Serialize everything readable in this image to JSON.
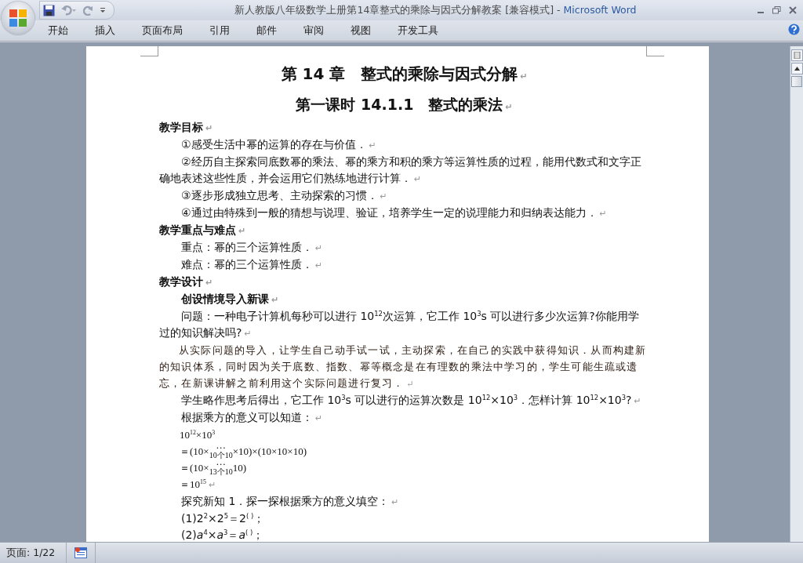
{
  "window": {
    "title": "新人教版八年级数学上册第14章整式的乘除与因式分解教案 [兼容模式]",
    "separator": " - ",
    "app": "Microsoft Word"
  },
  "tabs": [
    {
      "label": "开始",
      "selected": false
    },
    {
      "label": "插入",
      "selected": false
    },
    {
      "label": "页面布局",
      "selected": false
    },
    {
      "label": "引用",
      "selected": false
    },
    {
      "label": "邮件",
      "selected": false
    },
    {
      "label": "审阅",
      "selected": false
    },
    {
      "label": "视图",
      "selected": false
    },
    {
      "label": "开发工具",
      "selected": false
    }
  ],
  "document": {
    "paragraphs": [
      {
        "kind": "heading1",
        "text": "第 14 章　整式的乘除与因式分解",
        "mark": "↵"
      },
      {
        "kind": "heading2",
        "text": "第一课时 14.1.1　整式的乘法",
        "mark": "↵"
      },
      {
        "kind": "section",
        "text": "教学目标",
        "mark": "↵"
      },
      {
        "kind": "body",
        "text": "①感受生活中幂的运算的存在与价值．",
        "mark": "↵"
      },
      {
        "kind": "body",
        "text": "②经历自主探索同底数幂的乘法、幂的乘方和积的乘方等运算性质的过程，能用代数式和文字正确地表述这些性质，并会运用它们熟练地进行计算．",
        "mark": "↵"
      },
      {
        "kind": "body",
        "text": "③逐步形成独立思考、主动探索的习惯．",
        "mark": "↵"
      },
      {
        "kind": "body",
        "text": "④通过由特殊到一般的猜想与说理、验证，培养学生一定的说理能力和归纳表达能力．",
        "mark": "↵"
      },
      {
        "kind": "section",
        "text": "教学重点与难点",
        "mark": "↵"
      },
      {
        "kind": "body",
        "text": "重点：幂的三个运算性质．",
        "mark": "↵"
      },
      {
        "kind": "body",
        "text": "难点：幂的三个运算性质．",
        "mark": "↵"
      },
      {
        "kind": "section",
        "text": "教学设计",
        "mark": "↵"
      },
      {
        "kind": "subsection",
        "text": "创设情境导入新课",
        "mark": "↵"
      },
      {
        "kind": "body",
        "text": "问题：一种电子计算机每秒可以进行 10$^{12}$次运算，它工作 10$^{3}$s 可以进行多少次运算?你能用学过的知识解决吗?",
        "mark": "↵"
      },
      {
        "kind": "note",
        "text": "从实际问题的导入，让学生自己动手试一试，主动探索，在自己的实践中获得知识．从而构建新的知识体系，同时因为关于底数、指数、幂等概念是在有理数的乘法中学习的，学生可能生疏或遗忘，在新课讲解之前利用这个实际问题进行复习．",
        "mark": "↵"
      },
      {
        "kind": "body",
        "text": "学生略作思考后得出，它工作 10$^{3}$s 可以进行的运算次数是 10$^{12}$×10$^{3}$．怎样计算 10$^{12}$×10$^{3}$?",
        "mark": "↵"
      },
      {
        "kind": "body",
        "text": "根据乘方的意义可以知道：",
        "mark": "↵"
      },
      {
        "kind": "math",
        "text": "10$^{12}$×10$^{3}$"
      },
      {
        "kind": "brace",
        "before": "＝(10×",
        "dots": "···",
        "under": "10个10",
        "after": "×10)×(10×10×10)"
      },
      {
        "kind": "brace",
        "before": "＝(10×",
        "dots": "···",
        "under": "13个10",
        "after": "10)"
      },
      {
        "kind": "math",
        "text": "＝10$^{15}$",
        "mark": "↵"
      },
      {
        "kind": "body",
        "text": "探究新知 1．探一探根据乘方的意义填空：",
        "mark": "↵"
      },
      {
        "kind": "body",
        "text": "(1)2$^{2}$×2$^{5}$＝2$^{( )}$；"
      },
      {
        "kind": "body",
        "text": "(2)*a*$^{4}$×*a*$^{3}$＝*a*$^{( )}$；"
      }
    ]
  },
  "status_bar": {
    "page": "页面: 1/22"
  }
}
